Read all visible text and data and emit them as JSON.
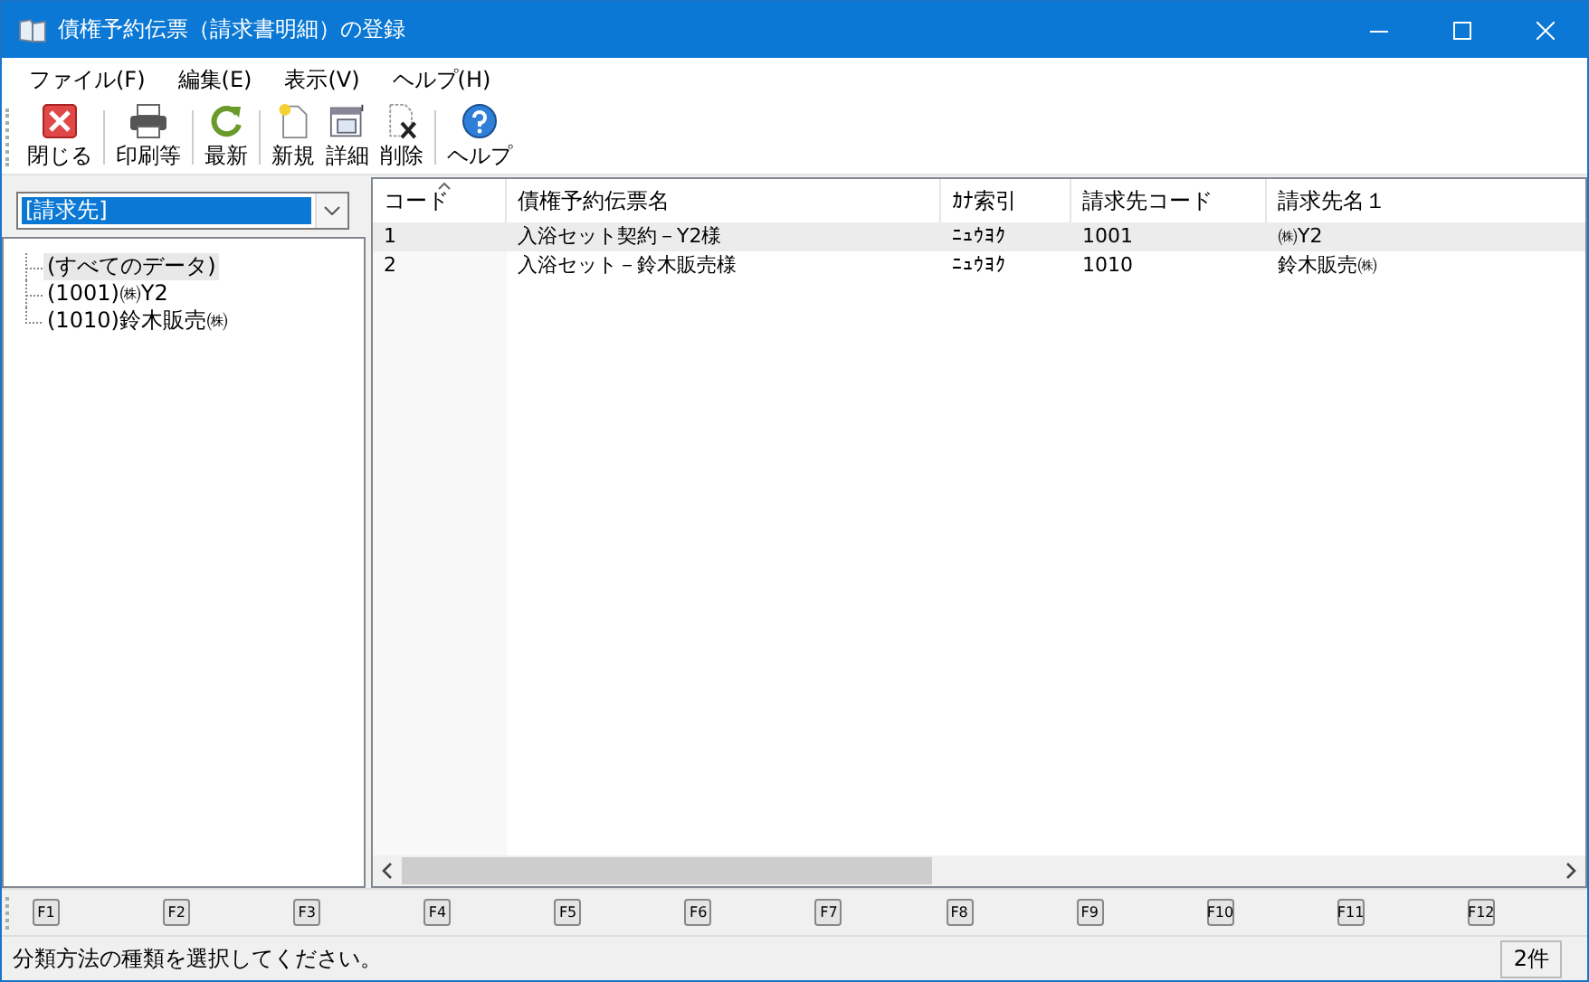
{
  "window": {
    "title": "債権予約伝票（請求書明細）の登録"
  },
  "menu": [
    "ファイル(F)",
    "編集(E)",
    "表示(V)",
    "ヘルプ(H)"
  ],
  "toolbar": [
    {
      "kind": "close",
      "label": "閉じる"
    },
    {
      "kind": "print",
      "label": "印刷等"
    },
    {
      "kind": "refresh",
      "label": "最新"
    },
    {
      "kind": "new",
      "label": "新規"
    },
    {
      "kind": "detail",
      "label": "詳細"
    },
    {
      "kind": "delete",
      "label": "削除"
    },
    {
      "kind": "help",
      "label": "ヘルプ"
    }
  ],
  "classifier": {
    "value": "[請求先]"
  },
  "tree": [
    {
      "label": "(すべてのデータ)",
      "selected": true
    },
    {
      "label": "(1001)㈱Y2",
      "selected": false
    },
    {
      "label": "(1010)鈴木販売㈱",
      "selected": false
    }
  ],
  "table": {
    "columns": [
      "コード",
      "債権予約伝票名",
      "ｶﾅ索引",
      "請求先コード",
      "請求先名１"
    ],
    "rows": [
      {
        "cells": [
          "1",
          "入浴セット契約－Y2様",
          "ﾆｭｳﾖｸ",
          "1001",
          "㈱Y2"
        ],
        "selected": true
      },
      {
        "cells": [
          "2",
          "入浴セット－鈴木販売様",
          "ﾆｭｳﾖｸ",
          "1010",
          "鈴木販売㈱"
        ],
        "selected": false
      }
    ]
  },
  "function_keys": [
    "F1",
    "F2",
    "F3",
    "F4",
    "F5",
    "F6",
    "F7",
    "F8",
    "F9",
    "F10",
    "F11",
    "F12"
  ],
  "status_bar": {
    "message": "分類方法の種類を選択してください。",
    "count": "2件"
  }
}
